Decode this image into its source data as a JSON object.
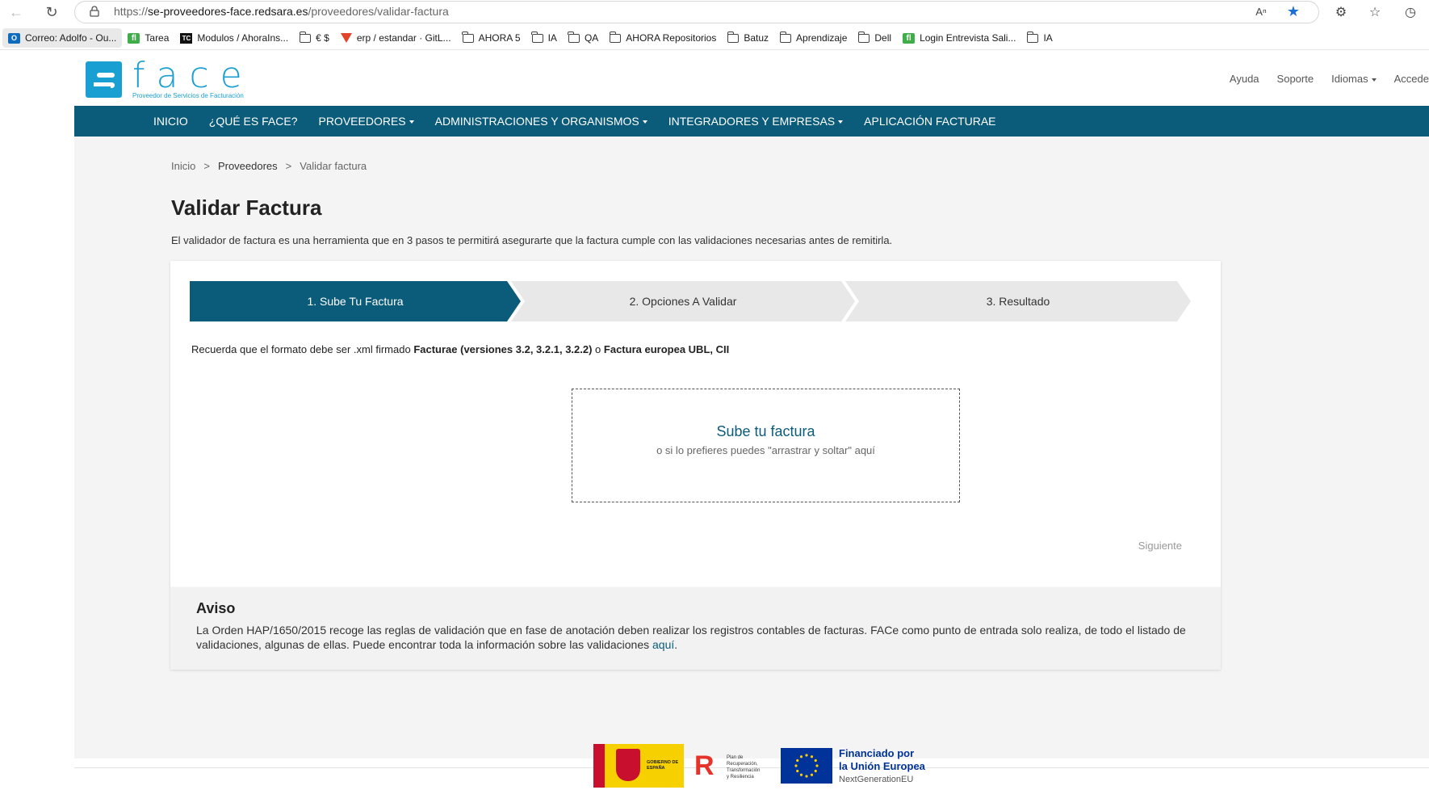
{
  "browser": {
    "url_prefix": "https://",
    "url_domain": "se-proveedores-face.redsara.es",
    "url_path": "/proveedores/validar-factura",
    "bookmarks": [
      {
        "label": "Correo: Adolfo - Ou...",
        "icon": "outlook-icon"
      },
      {
        "label": "Tarea",
        "icon": "fl-icon"
      },
      {
        "label": "Modulos / AhoraIns...",
        "icon": "tc-icon"
      },
      {
        "label": "€ $",
        "icon": "folder-icon"
      },
      {
        "label": "erp / estandar · GitL...",
        "icon": "gitlab-icon"
      },
      {
        "label": "AHORA 5",
        "icon": "folder-icon"
      },
      {
        "label": "IA",
        "icon": "folder-icon"
      },
      {
        "label": "QA",
        "icon": "folder-icon"
      },
      {
        "label": "AHORA Repositorios",
        "icon": "folder-icon"
      },
      {
        "label": "Batuz",
        "icon": "folder-icon"
      },
      {
        "label": "Aprendizaje",
        "icon": "folder-icon"
      },
      {
        "label": "Dell",
        "icon": "folder-icon"
      },
      {
        "label": "Login Entrevista Sali...",
        "icon": "fl-icon"
      },
      {
        "label": "IA",
        "icon": "folder-icon"
      }
    ]
  },
  "logo": {
    "letters": "face",
    "subtitle": "Proveedor de Servicios de Facturación"
  },
  "toplinks": {
    "help": "Ayuda",
    "support": "Soporte",
    "languages": "Idiomas",
    "access": "Accede"
  },
  "mainnav": {
    "items": [
      "INICIO",
      "¿QUÉ ES FACE?",
      "PROVEEDORES",
      "ADMINISTRACIONES Y ORGANISMOS",
      "INTEGRADORES Y EMPRESAS",
      "APLICACIÓN FACTURAE"
    ]
  },
  "breadcrumb": {
    "items": [
      "Inicio",
      "Proveedores",
      "Validar factura"
    ],
    "separator": ">"
  },
  "page": {
    "title": "Validar Factura",
    "intro": "El validador de factura es una herramienta que en 3 pasos te permitirá asegurarte que la factura cumple con las validaciones necesarias antes de remitirla."
  },
  "steps": [
    {
      "label": "1. Sube Tu Factura",
      "active": true
    },
    {
      "label": "2. Opciones A Validar",
      "active": false
    },
    {
      "label": "3. Resultado",
      "active": false
    }
  ],
  "format_note": {
    "prefix": "Recuerda que el formato debe ser .xml firmado ",
    "bold1": "Facturae (versiones 3.2, 3.2.1, 3.2.2)",
    "middle": " o ",
    "bold2": "Factura europea UBL, CII"
  },
  "dropzone": {
    "title": "Sube tu factura",
    "subtitle": "o si lo prefieres puedes \"arrastrar y soltar\" aquí"
  },
  "next_label": "Siguiente",
  "aviso": {
    "title": "Aviso",
    "text": "La Orden HAP/1650/2015 recoge las reglas de validación que en fase de anotación deben realizar los registros contables de facturas. FACe como punto de entrada solo realiza, de todo el listado de validaciones, algunas de ellas. Puede encontrar toda la información sobre las validaciones ",
    "link": "aquí",
    "end": "."
  },
  "footer": {
    "gobierno": "GOBIERNO DE ESPAÑA",
    "plan": [
      "Plan de",
      "Recuperación,",
      "Transformación",
      "y Resiliencia"
    ],
    "eu_line1": "Financiado por",
    "eu_line2": "la Unión Europea",
    "eu_line3": "NextGenerationEU"
  },
  "colors": {
    "brand_blue": "#1a9fd2",
    "nav_blue": "#0b5b7a",
    "step_inactive": "#e8e8e8"
  }
}
